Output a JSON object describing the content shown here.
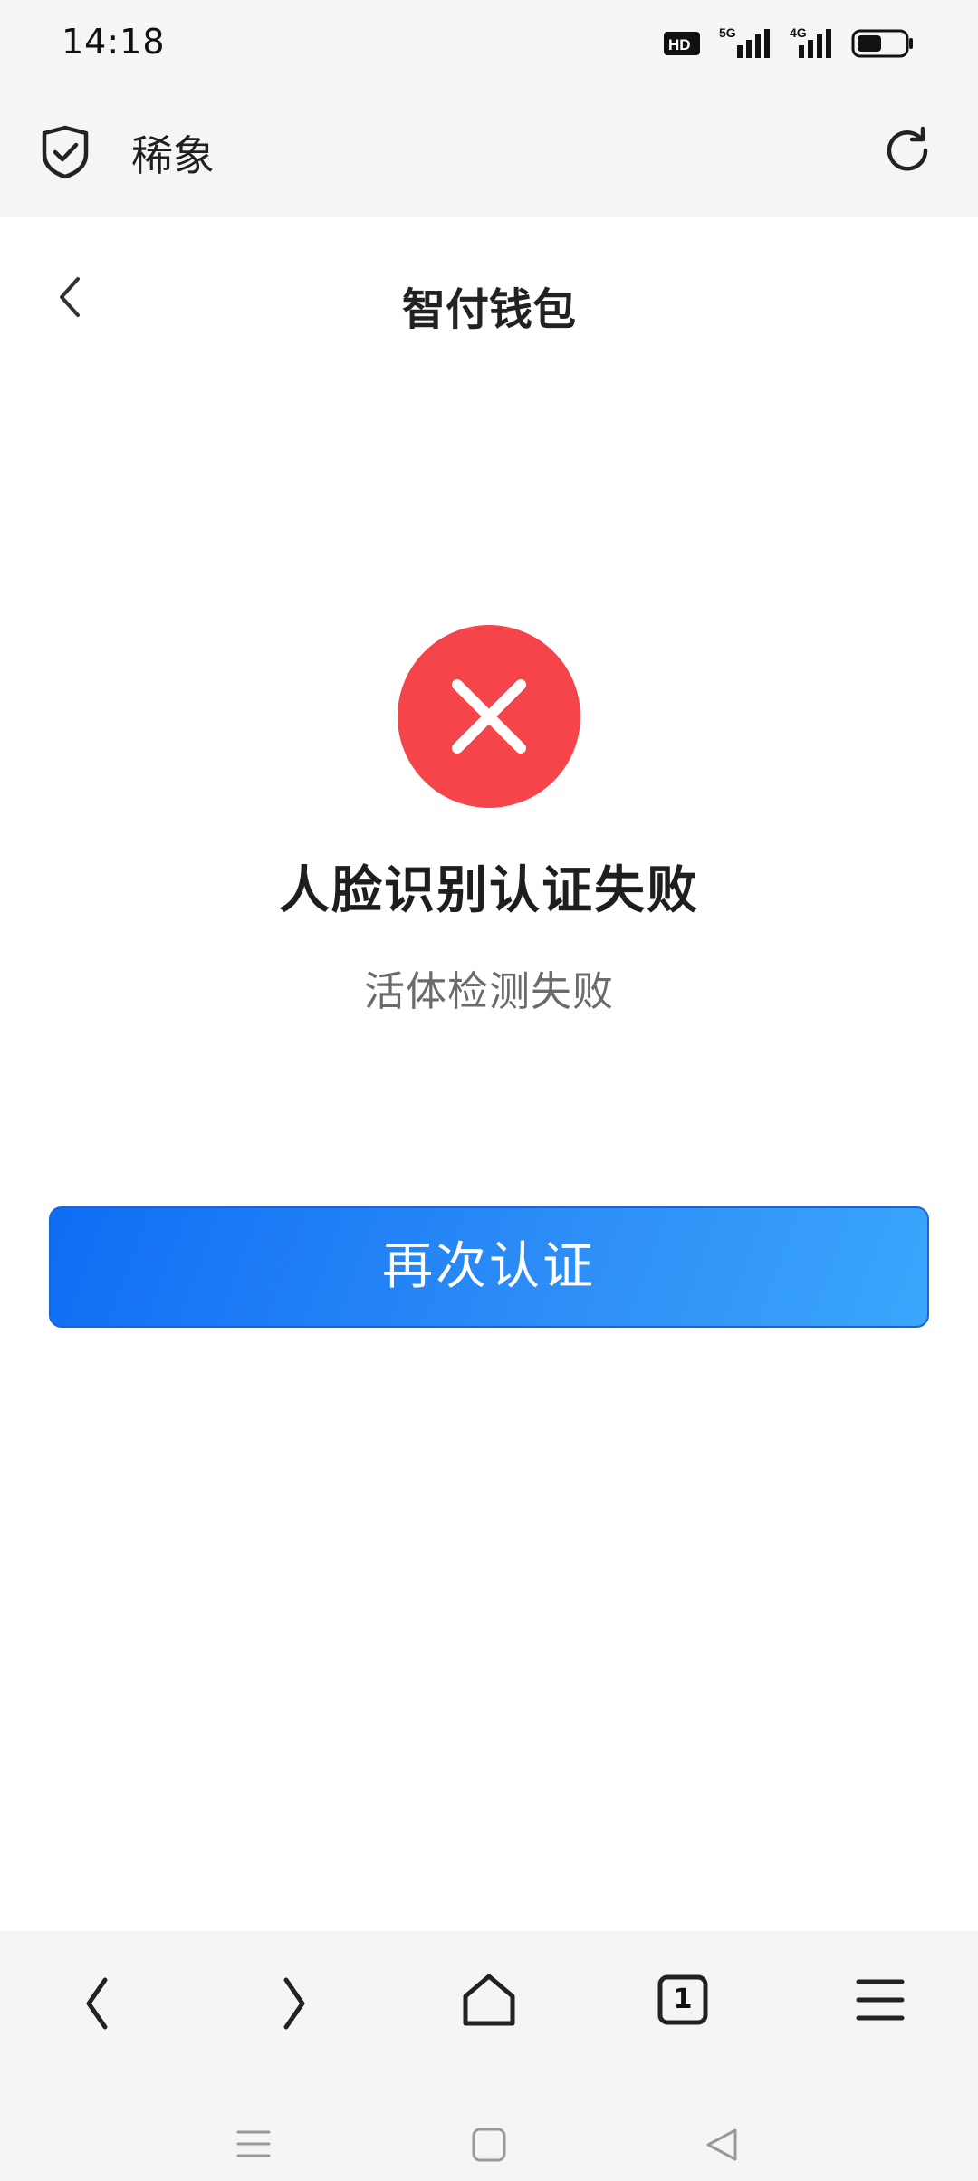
{
  "status_bar": {
    "time": "14:18",
    "icons": [
      "hd-icon",
      "signal-5g-icon",
      "signal-4g-icon",
      "battery-icon"
    ],
    "hd_label": "HD",
    "network_5g": "5G",
    "network_4g": "4G"
  },
  "browser": {
    "site_title": "稀象",
    "icons": [
      "shield-check-icon",
      "refresh-icon"
    ]
  },
  "page": {
    "title": "智付钱包",
    "result_title": "人脸识别认证失败",
    "result_subtitle": "活体检测失败",
    "retry_label": "再次认证"
  },
  "bottom_nav": {
    "tab_count": "1",
    "items": [
      "back-icon",
      "forward-icon",
      "home-icon",
      "tabs-icon",
      "menu-icon"
    ]
  },
  "colors": {
    "error_red": "#f5454b",
    "button_blue_start": "#0f6df4",
    "button_blue_end": "#3aa6fb",
    "bar_gray": "#f5f5f5"
  }
}
